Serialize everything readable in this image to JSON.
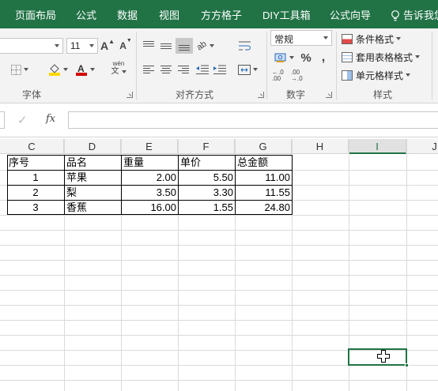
{
  "ribbon_tabs": [
    "页面布局",
    "公式",
    "数据",
    "视图",
    "方方格子",
    "DIY工具箱",
    "公式向导",
    "告诉我您"
  ],
  "font_group": {
    "font_name": "",
    "font_size": "11",
    "label": "字体",
    "grow_label": "A",
    "shrink_label": "A",
    "font_color": "#d00000",
    "fill_color": "#ffd800",
    "phonetic_label": "wén"
  },
  "align_group": {
    "label": "对齐方式"
  },
  "number_group": {
    "format": "常规",
    "label": "数字",
    "percent": "%",
    "comma": ",",
    "inc_decimal": "←.0 .00",
    "dec_decimal": ".00 →.0"
  },
  "style_group": {
    "label": "样式",
    "conditional": "条件格式",
    "table_format": "套用表格格式",
    "cell_styles": "单元格样式"
  },
  "formula_bar": {
    "fx": "fx",
    "value": ""
  },
  "columns": [
    "C",
    "D",
    "E",
    "F",
    "G",
    "H",
    "I",
    "J"
  ],
  "selected_column": "I",
  "table": {
    "headers": [
      "序号",
      "品名",
      "重量",
      "单价",
      "总金额"
    ],
    "rows": [
      [
        "1",
        "苹果",
        "2.00",
        "5.50",
        "11.00"
      ],
      [
        "2",
        "梨",
        "3.50",
        "3.30",
        "11.55"
      ],
      [
        "3",
        "香蕉",
        "16.00",
        "1.55",
        "24.80"
      ]
    ]
  },
  "theme": {
    "accent": "#217346",
    "ribbon_bg": "#f3f3f3"
  }
}
